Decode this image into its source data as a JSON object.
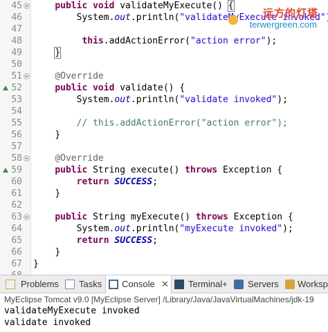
{
  "editor": {
    "lines": [
      {
        "no": "45",
        "fold": true,
        "marker": false,
        "indent": 4,
        "tokens": [
          {
            "t": "public void ",
            "c": "kw"
          },
          {
            "t": "validateMyExecute() ",
            "c": ""
          },
          {
            "t": "{",
            "c": "box"
          }
        ]
      },
      {
        "no": "46",
        "fold": false,
        "marker": false,
        "indent": 8,
        "tokens": [
          {
            "t": "System.",
            "c": ""
          },
          {
            "t": "out",
            "c": "fld"
          },
          {
            "t": ".println(",
            "c": ""
          },
          {
            "t": "\"validateMyExecute invoked\"",
            "c": "str"
          },
          {
            "t": ");",
            "c": ""
          }
        ]
      },
      {
        "no": "47",
        "fold": false,
        "marker": false,
        "indent": 0,
        "tokens": []
      },
      {
        "no": "48",
        "fold": false,
        "marker": false,
        "indent": 9,
        "tokens": [
          {
            "t": "this",
            "c": "kw"
          },
          {
            "t": ".addActionError(",
            "c": ""
          },
          {
            "t": "\"action error\"",
            "c": "str"
          },
          {
            "t": ");",
            "c": ""
          }
        ]
      },
      {
        "no": "49",
        "fold": false,
        "marker": false,
        "indent": 4,
        "tokens": [
          {
            "t": "}",
            "c": "box"
          }
        ]
      },
      {
        "no": "50",
        "fold": false,
        "marker": false,
        "indent": 0,
        "tokens": []
      },
      {
        "no": "51",
        "fold": true,
        "marker": false,
        "indent": 4,
        "tokens": [
          {
            "t": "@Override",
            "c": "ann"
          }
        ]
      },
      {
        "no": "52",
        "fold": false,
        "marker": true,
        "indent": 4,
        "tokens": [
          {
            "t": "public void ",
            "c": "kw"
          },
          {
            "t": "validate() {",
            "c": ""
          }
        ]
      },
      {
        "no": "53",
        "fold": false,
        "marker": false,
        "indent": 8,
        "tokens": [
          {
            "t": "System.",
            "c": ""
          },
          {
            "t": "out",
            "c": "fld"
          },
          {
            "t": ".println(",
            "c": ""
          },
          {
            "t": "\"validate invoked\"",
            "c": "str"
          },
          {
            "t": ");",
            "c": ""
          }
        ]
      },
      {
        "no": "54",
        "fold": false,
        "marker": false,
        "indent": 0,
        "tokens": []
      },
      {
        "no": "55",
        "fold": false,
        "marker": false,
        "indent": 8,
        "tokens": [
          {
            "t": "// this.addActionError(\"action error\");",
            "c": "cmt"
          }
        ]
      },
      {
        "no": "56",
        "fold": false,
        "marker": false,
        "indent": 4,
        "tokens": [
          {
            "t": "}",
            "c": ""
          }
        ]
      },
      {
        "no": "57",
        "fold": false,
        "marker": false,
        "indent": 0,
        "tokens": []
      },
      {
        "no": "58",
        "fold": true,
        "marker": false,
        "indent": 4,
        "tokens": [
          {
            "t": "@Override",
            "c": "ann"
          }
        ]
      },
      {
        "no": "59",
        "fold": false,
        "marker": true,
        "indent": 4,
        "tokens": [
          {
            "t": "public ",
            "c": "kw"
          },
          {
            "t": "String execute() ",
            "c": ""
          },
          {
            "t": "throws ",
            "c": "kw"
          },
          {
            "t": "Exception {",
            "c": ""
          }
        ]
      },
      {
        "no": "60",
        "fold": false,
        "marker": false,
        "indent": 8,
        "tokens": [
          {
            "t": "return ",
            "c": "kw"
          },
          {
            "t": "SUCCESS",
            "c": "cst"
          },
          {
            "t": ";",
            "c": ""
          }
        ]
      },
      {
        "no": "61",
        "fold": false,
        "marker": false,
        "indent": 4,
        "tokens": [
          {
            "t": "}",
            "c": ""
          }
        ]
      },
      {
        "no": "62",
        "fold": false,
        "marker": false,
        "indent": 0,
        "tokens": []
      },
      {
        "no": "63",
        "fold": true,
        "marker": false,
        "indent": 4,
        "tokens": [
          {
            "t": "public ",
            "c": "kw"
          },
          {
            "t": "String myExecute() ",
            "c": ""
          },
          {
            "t": "throws ",
            "c": "kw"
          },
          {
            "t": "Exception {",
            "c": ""
          }
        ]
      },
      {
        "no": "64",
        "fold": false,
        "marker": false,
        "indent": 8,
        "tokens": [
          {
            "t": "System.",
            "c": ""
          },
          {
            "t": "out",
            "c": "fld"
          },
          {
            "t": ".println(",
            "c": ""
          },
          {
            "t": "\"myExecute invoked\"",
            "c": "str"
          },
          {
            "t": ");",
            "c": ""
          }
        ]
      },
      {
        "no": "65",
        "fold": false,
        "marker": false,
        "indent": 8,
        "tokens": [
          {
            "t": "return ",
            "c": "kw"
          },
          {
            "t": "SUCCESS",
            "c": "cst"
          },
          {
            "t": ";",
            "c": ""
          }
        ]
      },
      {
        "no": "66",
        "fold": false,
        "marker": false,
        "indent": 4,
        "tokens": [
          {
            "t": "}",
            "c": ""
          }
        ]
      },
      {
        "no": "67",
        "fold": false,
        "marker": false,
        "indent": 0,
        "tokens": [
          {
            "t": "}",
            "c": ""
          }
        ]
      },
      {
        "no": "68",
        "fold": false,
        "marker": false,
        "indent": 0,
        "tokens": []
      }
    ]
  },
  "watermark": {
    "title": "远方的灯塔",
    "url": "terwergreen.com"
  },
  "tabs": [
    {
      "name": "problems",
      "label": "Problems",
      "icon": "problems-icon",
      "active": false
    },
    {
      "name": "tasks",
      "label": "Tasks",
      "icon": "tasks-icon",
      "active": false
    },
    {
      "name": "console",
      "label": "Console",
      "icon": "console-icon",
      "active": true,
      "close": "✕"
    },
    {
      "name": "terminal",
      "label": "Terminal+",
      "icon": "terminal-icon",
      "active": false
    },
    {
      "name": "servers",
      "label": "Servers",
      "icon": "servers-icon",
      "active": false
    },
    {
      "name": "workspace",
      "label": "Workspa",
      "icon": "workspace-icon",
      "active": false
    }
  ],
  "console": {
    "title": "MyEclipse Tomcat v9.0 [MyEclipse Server] /Library/Java/JavaVirtualMachines/jdk-19",
    "output": [
      "validateMyExecute invoked",
      "validate invoked"
    ]
  },
  "colors": {
    "keyword": "#7f0055",
    "string": "#2a00ff",
    "field": "#0000c0",
    "comment": "#3f7f5f",
    "annotation": "#646464",
    "marker": "#3b8a3e"
  }
}
